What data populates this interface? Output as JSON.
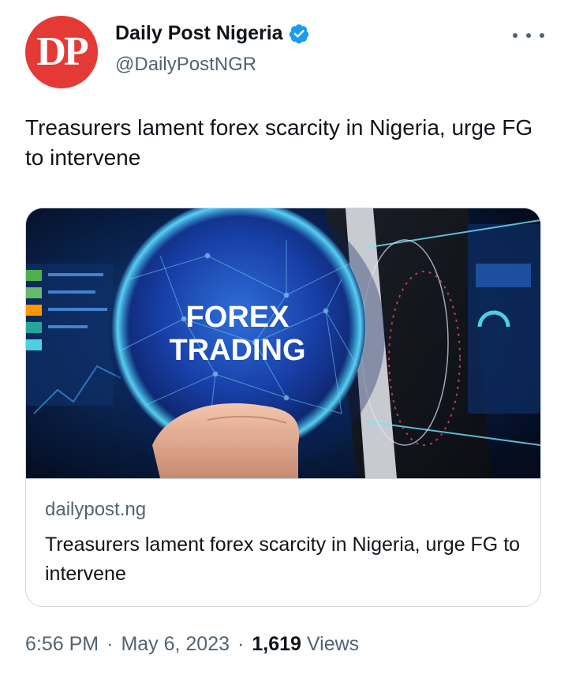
{
  "author": {
    "avatar_text": "DP",
    "display_name": "Daily Post Nigeria",
    "handle": "@DailyPostNGR",
    "verified_icon": "verified-badge-icon",
    "avatar_color": "#e53935",
    "verified_color": "#1d9bf0"
  },
  "tweet": {
    "text": "Treasurers lament forex scarcity in Nigeria, urge FG to intervene"
  },
  "card": {
    "image_text_line1": "FOREX",
    "image_text_line2": "TRADING",
    "domain": "dailypost.ng",
    "title": "Treasurers lament forex scarcity in Nigeria, urge FG to intervene"
  },
  "meta": {
    "time": "6:56 PM",
    "separator": "·",
    "date": "May 6, 2023",
    "views_count": "1,619",
    "views_label": "Views"
  },
  "menu": {
    "more_icon": "more-options-icon"
  }
}
